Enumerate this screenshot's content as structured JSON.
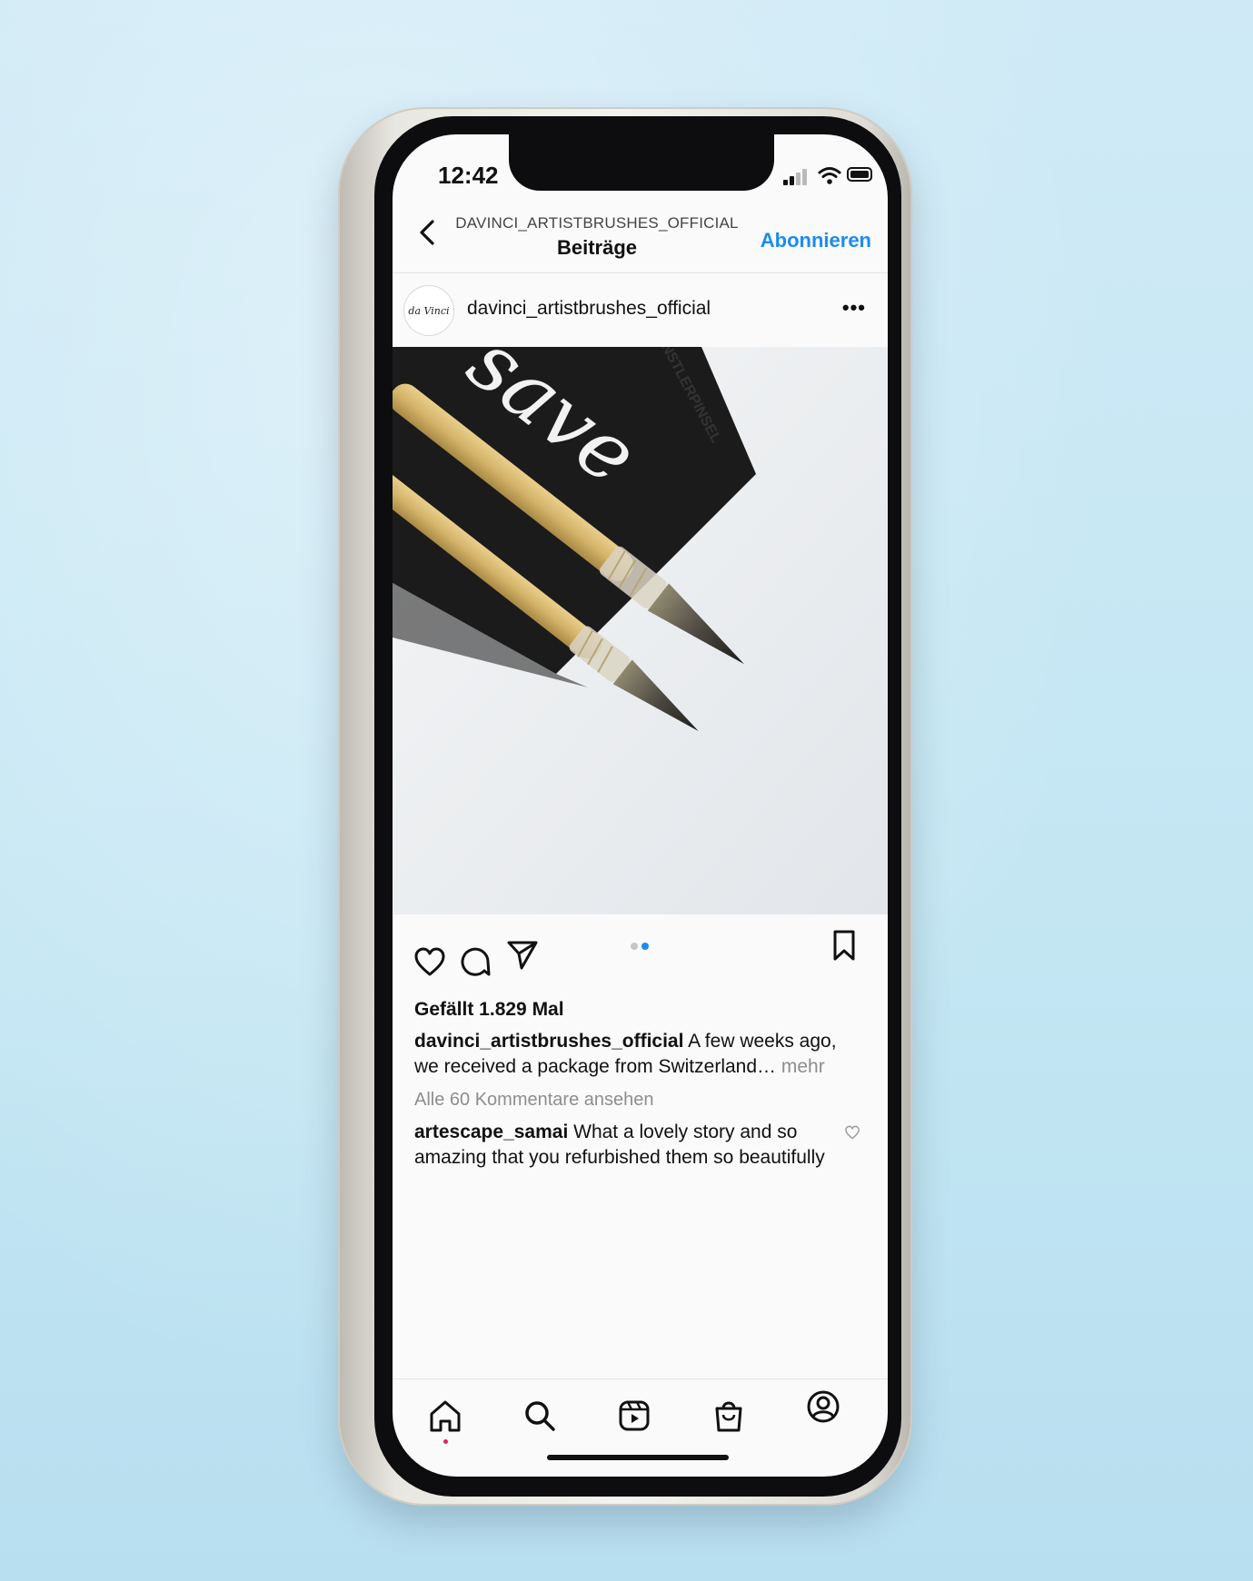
{
  "status_bar": {
    "time": "12:42"
  },
  "header": {
    "username": "DAVINCI_ARTISTBRUSHES_OFFICIAL",
    "title": "Beiträge",
    "follow_label": "Abonnieren"
  },
  "post": {
    "avatar_text": "da Vinci",
    "username": "davinci_artistbrushes_official",
    "image_text": "KÜNSTLERPINSEL",
    "carousel": {
      "count": 2,
      "active_index": 1
    },
    "likes": "Gefällt 1.829 Mal",
    "caption_user": "davinci_artistbrushes_official",
    "caption_text": " A few weeks ago, we received a package from Switzerland…",
    "caption_more": " mehr",
    "view_comments": "Alle 60 Kommentare ansehen",
    "comment_user": "artescape_samai",
    "comment_text": " What a lovely story and so amazing that you refurbished them so beautifully"
  },
  "tab_bar": {
    "items": [
      "home-icon",
      "search-icon",
      "reels-icon",
      "shop-icon",
      "profile-icon"
    ],
    "active": "home-icon"
  },
  "colors": {
    "accent": "#1a8cf0",
    "background": "#c3e6f3",
    "notification_dot": "#e0245e"
  }
}
